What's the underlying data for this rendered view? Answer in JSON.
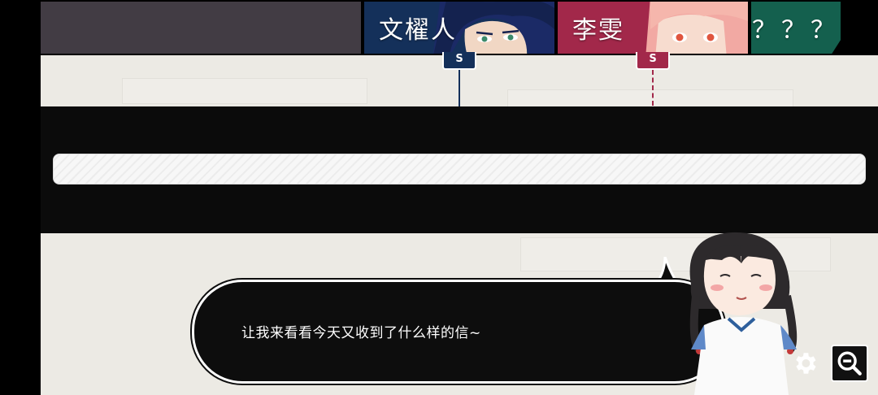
{
  "tabs": [
    {
      "name": "",
      "color": "#423c44"
    },
    {
      "name": "文櫂人",
      "color": "#14305a"
    },
    {
      "name": "李雯",
      "color": "#a2284a"
    },
    {
      "name": "？？？",
      "color": "#14604e"
    }
  ],
  "markers": [
    {
      "label": "S",
      "color": "#14305a",
      "line": "solid"
    },
    {
      "label": "S",
      "color": "#a2284a",
      "line": "dashed"
    }
  ],
  "progress": {
    "fraction": 0
  },
  "dialogue": {
    "text": "让我来看看今天又收到了什么样的信~"
  },
  "buttons": {
    "settings_icon": "gear-icon",
    "zoom_icon": "zoom-out-icon"
  }
}
